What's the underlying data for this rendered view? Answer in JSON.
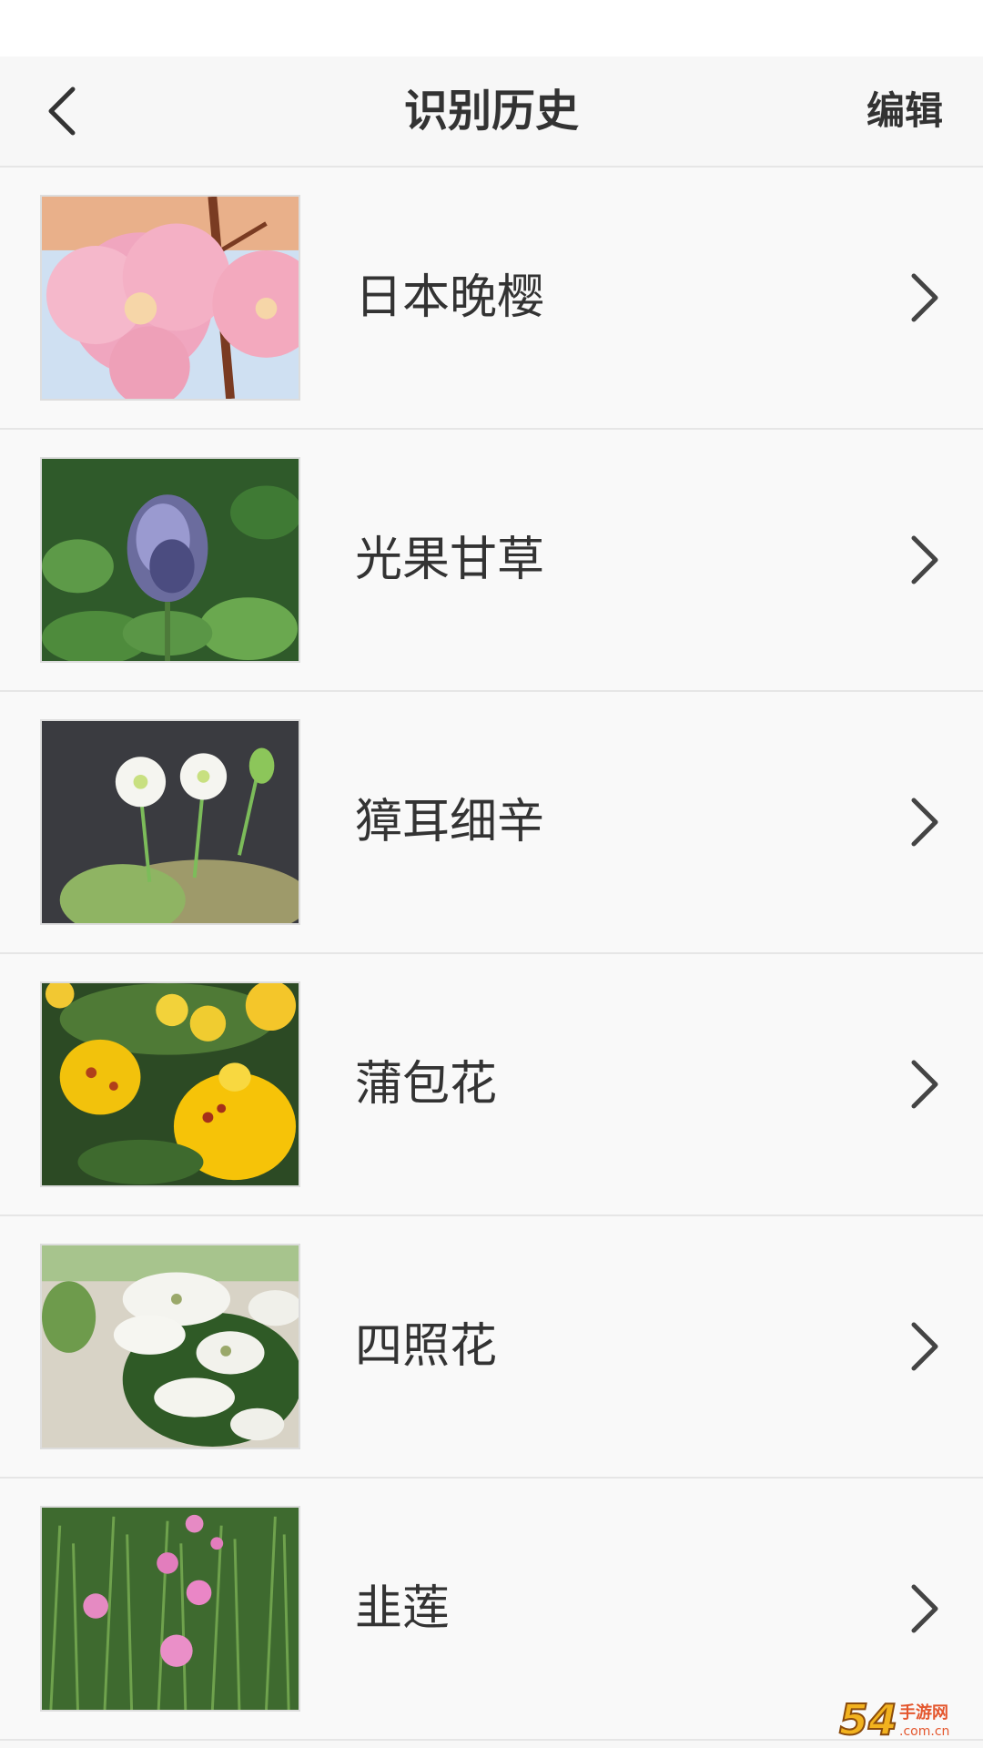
{
  "header": {
    "title": "识别历史",
    "edit_label": "编辑"
  },
  "history": [
    {
      "name": "日本晚樱",
      "image": "pink-cherry-blossom-photo"
    },
    {
      "name": "光果甘草",
      "image": "purple-licorice-flower-photo"
    },
    {
      "name": "獐耳细辛",
      "image": "white-hepatica-flower-photo"
    },
    {
      "name": "蒲包花",
      "image": "yellow-calceolaria-flower-photo"
    },
    {
      "name": "四照花",
      "image": "white-dogwood-flower-photo"
    },
    {
      "name": "韭莲",
      "image": "pink-rain-lily-photo"
    }
  ],
  "icons": {
    "back": "chevron-left-icon",
    "row_arrow": "chevron-right-icon"
  },
  "watermark": {
    "number": "54",
    "brand": "手游网",
    "url": ".com.cn"
  },
  "colors": {
    "background": "#f7f7f7",
    "text": "#333333",
    "divider": "#e6e6e6"
  }
}
